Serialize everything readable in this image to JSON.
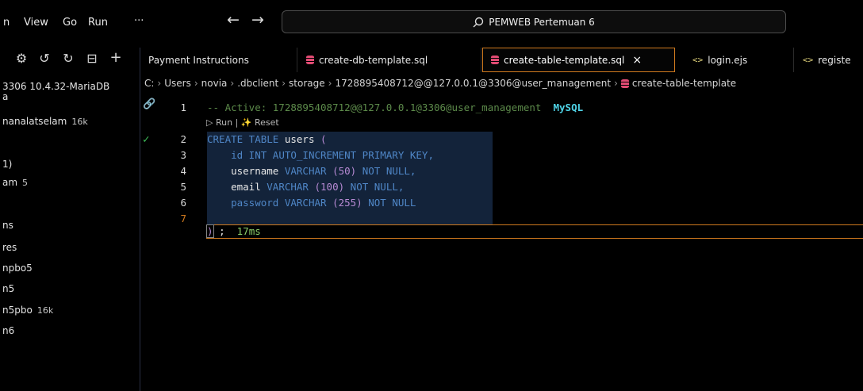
{
  "menu": [
    "n",
    "View",
    "Go",
    "Run",
    "···"
  ],
  "search": {
    "text": "PEMWEB Pertemuan 6"
  },
  "sidebar": {
    "connection": "3306 10.4.32-MariaDB",
    "items": [
      {
        "label": "a",
        "meta": ""
      },
      {
        "label": "nanalatselam",
        "meta": "16k"
      },
      {
        "label": "1)",
        "meta": ""
      },
      {
        "label": "am",
        "meta": "5"
      },
      {
        "label": "ns",
        "meta": ""
      },
      {
        "label": "res",
        "meta": ""
      },
      {
        "label": "npbo5",
        "meta": ""
      },
      {
        "label": "n5",
        "meta": ""
      },
      {
        "label": "n5pbo",
        "meta": "16k"
      },
      {
        "label": "n6",
        "meta": ""
      }
    ]
  },
  "tabs": [
    {
      "label": "Payment Instructions",
      "icon": "none"
    },
    {
      "label": "create-db-template.sql",
      "icon": "database-icon"
    },
    {
      "label": "create-table-template.sql",
      "icon": "database-icon",
      "close": "×"
    },
    {
      "label": "login.ejs",
      "icon": "code-icon"
    },
    {
      "label": "registe",
      "icon": "code-icon"
    }
  ],
  "breadcrumb": [
    "C:",
    "Users",
    "novia",
    ".dbclient",
    "storage",
    "1728895408712@@127.0.0.1@3306@user_management",
    "create-table-template"
  ],
  "editor": {
    "comment": "-- Active: 1728895408712@@127.0.0.1@3306@user_management",
    "dialect": "MySQL",
    "codelens": "▷ Run | ✨ Reset",
    "line_numbers": [
      "1",
      "2",
      "3",
      "4",
      "5",
      "6",
      "7"
    ],
    "timing": "17ms"
  },
  "colors": {
    "accent": "#d07a1e",
    "db_icon": "#e14b73",
    "keyword": "#4f86c6",
    "number": "#b78ad4"
  }
}
